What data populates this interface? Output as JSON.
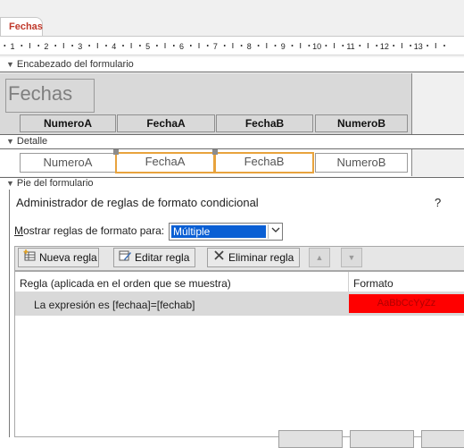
{
  "tab": {
    "label": "Fechas"
  },
  "ruler": {
    "numbers": [
      "1",
      "2",
      "3",
      "4",
      "5",
      "6",
      "7",
      "8",
      "9",
      "10",
      "11",
      "12",
      "13"
    ]
  },
  "form_designer": {
    "header_section": "Encabezado del formulario",
    "title": "Fechas",
    "header_labels": [
      "NumeroA",
      "FechaA",
      "FechaB",
      "NumeroB"
    ],
    "detail_section": "Detalle",
    "detail_fields": [
      "NumeroA",
      "FechaA",
      "FechaB",
      "NumeroB"
    ],
    "footer_section": "Pie del formulario"
  },
  "dialog": {
    "title": "Administrador de reglas de formato condicional",
    "help": "?",
    "show_rules_label": "Mostrar reglas de formato para:",
    "show_rules_value": "Múltiple",
    "toolbar": {
      "new_rule": "Nueva regla",
      "edit_rule": "Editar regla",
      "delete_rule": "Eliminar regla"
    },
    "columns": {
      "rule": "Regla (aplicada en el orden que se muestra)",
      "format": "Formato"
    },
    "rules": [
      {
        "text": "La expresión es [fechaa]=[fechab]",
        "format_preview": "AaBbCcYyZz",
        "format_color": "#ff0000"
      }
    ]
  }
}
